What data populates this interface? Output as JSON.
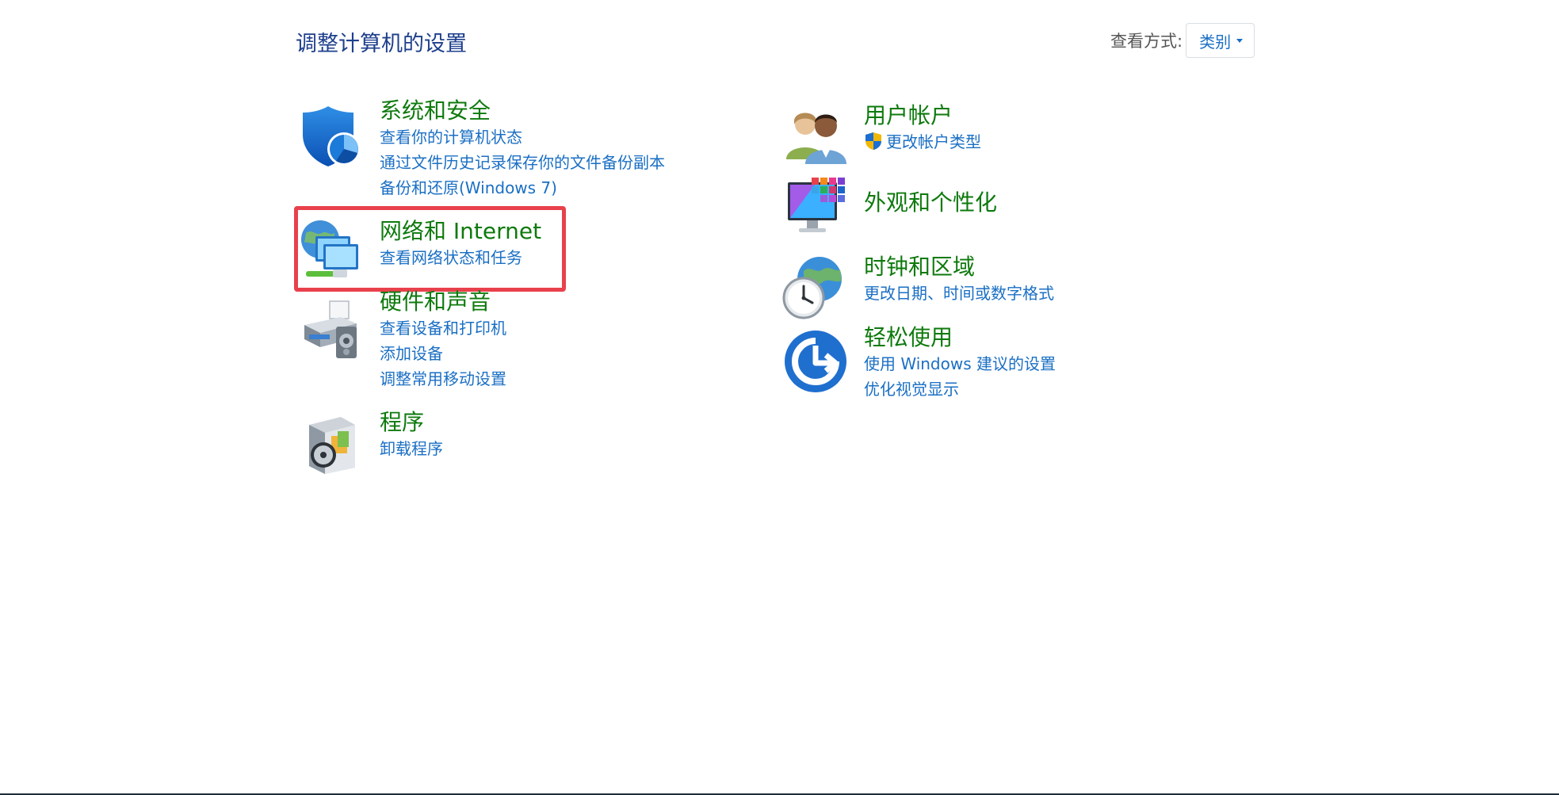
{
  "header": {
    "title": "调整计算机的设置",
    "view_by_label": "查看方式:",
    "view_by_value": "类别"
  },
  "categories": [
    {
      "id": "system-security",
      "icon": "shield-icon",
      "title": "系统和安全",
      "links": [
        "查看你的计算机状态",
        "通过文件历史记录保存你的文件备份副本",
        "备份和还原(Windows 7)"
      ]
    },
    {
      "id": "network-internet",
      "icon": "network-globe-icon",
      "title": "网络和 Internet",
      "links": [
        "查看网络状态和任务"
      ],
      "highlighted": true
    },
    {
      "id": "hardware-sound",
      "icon": "printer-icon",
      "title": "硬件和声音",
      "links": [
        "查看设备和打印机",
        "添加设备",
        "调整常用移动设置"
      ]
    },
    {
      "id": "programs",
      "icon": "programs-disc-icon",
      "title": "程序",
      "links": [
        "卸载程序"
      ]
    },
    {
      "id": "user-accounts",
      "icon": "users-icon",
      "title": "用户帐户",
      "links": [
        "更改帐户类型"
      ]
    },
    {
      "id": "appearance",
      "icon": "monitor-tiles-icon",
      "title": "外观和个性化",
      "links": []
    },
    {
      "id": "clock-region",
      "icon": "clock-globe-icon",
      "title": "时钟和区域",
      "links": [
        "更改日期、时间或数字格式"
      ]
    },
    {
      "id": "ease-of-access",
      "icon": "ease-of-access-icon",
      "title": "轻松使用",
      "links": [
        "使用 Windows 建议的设置",
        "优化视觉显示"
      ]
    }
  ],
  "colors": {
    "title_green": "#0e7a0d",
    "link_blue": "#1a6fc4",
    "header_blue": "#1e3f8c",
    "highlight_red": "#e8414c"
  }
}
